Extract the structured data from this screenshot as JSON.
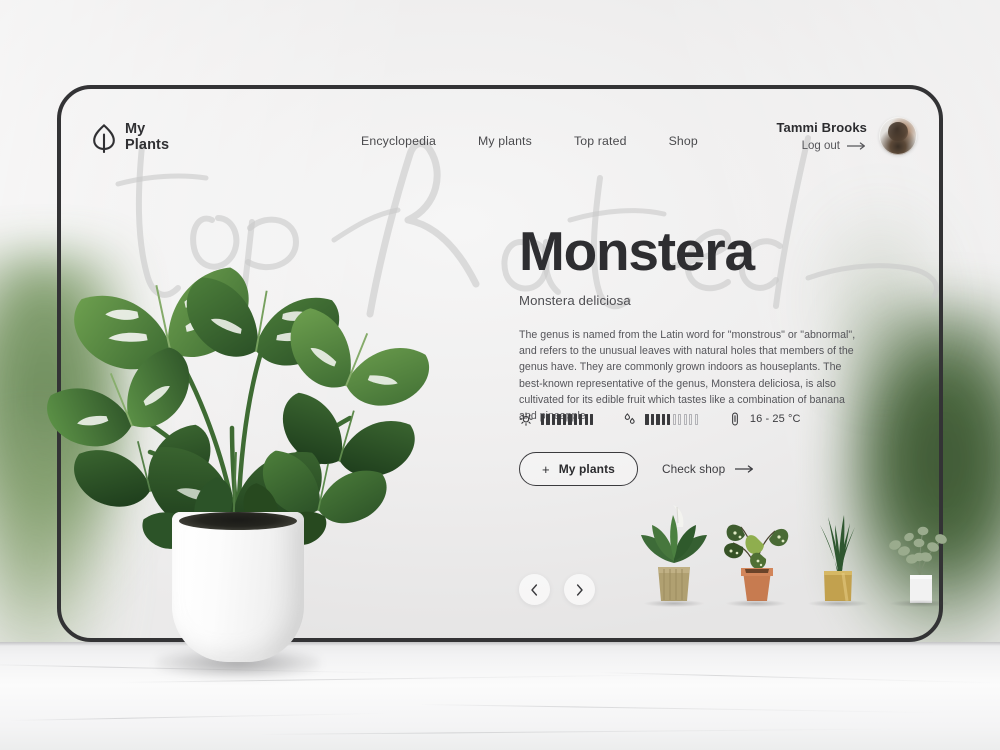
{
  "brand": {
    "line1": "My",
    "line2": "Plants",
    "logo_icon": "leaf-icon"
  },
  "nav": {
    "items": [
      {
        "label": "Encyclopedia"
      },
      {
        "label": "My plants"
      },
      {
        "label": "Top rated"
      },
      {
        "label": "Shop"
      }
    ]
  },
  "user": {
    "name": "Tammi Brooks",
    "logout_label": "Log out",
    "logout_icon": "arrow-right-icon",
    "avatar_icon": "user-avatar"
  },
  "watermark": {
    "text": "top Rated"
  },
  "hero": {
    "title": "Monstera",
    "subtitle": "Monstera deliciosa",
    "description": "The genus is named from the Latin word for \"monstrous\" or \"abnormal\", and refers to the unusual leaves with natural holes that members of the genus have. They are commonly grown indoors as houseplants. The best-known representative of the genus, Monstera deliciosa, is also cultivated for its edible fruit which tastes like a combination of banana and pineapple."
  },
  "stats": [
    {
      "name": "light-level",
      "icon": "sun-icon",
      "filled": 10,
      "total": 10,
      "value_text": ""
    },
    {
      "name": "water-level",
      "icon": "water-drops-icon",
      "filled": 5,
      "total": 10,
      "value_text": ""
    },
    {
      "name": "temperature-range",
      "icon": "thermometer-icon",
      "filled": 0,
      "total": 0,
      "value_text": "16 - 25 °C"
    }
  ],
  "cta": {
    "primary_label": "My plants",
    "primary_prefix": "+",
    "secondary_label": "Check shop",
    "secondary_icon": "arrow-right-icon"
  },
  "carousel": {
    "prev_icon": "chevron-left-icon",
    "next_icon": "chevron-right-icon",
    "thumbnails": [
      {
        "name": "peace-lily-thumbnail",
        "pot_color": "#b0a071",
        "leaf_color": "#3d6b38"
      },
      {
        "name": "polka-dot-begonia-thumbnail",
        "pot_color": "#c77b50",
        "leaf_color": "#53713c"
      },
      {
        "name": "snake-plant-thumbnail",
        "pot_color": "#c2a14e",
        "leaf_color": "#2f5730"
      },
      {
        "name": "eucalyptus-thumbnail",
        "pot_color": "#f2f2f2",
        "leaf_color": "#8fa184"
      }
    ]
  },
  "colors": {
    "frame": "#333335",
    "text_dark": "#2e2e31",
    "text_muted": "#55555a",
    "leaf_green": "#3f6b32"
  }
}
